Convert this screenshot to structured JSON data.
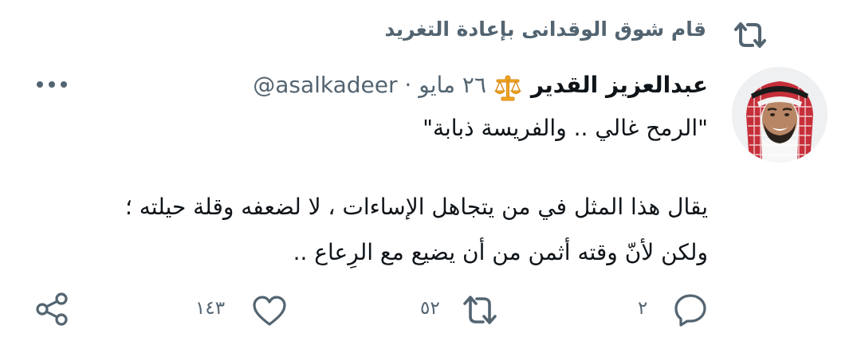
{
  "retweet": {
    "icon": "retweet-icon",
    "text": "قام شوق الوقدانى بإعادة التغريد"
  },
  "tweet": {
    "author_name": "عبدالعزيز القدير",
    "badge_icon": "scales-emoji",
    "handle": "@asalkadeer",
    "separator": "·",
    "date": "٢٦ مايو",
    "lines": [
      "\"الرمح غالي .. والفريسة ذبابة\"",
      "يقال هذا المثل في من يتجاهل الإساءات ، لا لضعفه وقلة حيلته ؛",
      "ولكن لأنّ وقته أثمن من أن يضيع مع الرِعاع .."
    ]
  },
  "actions": {
    "reply_count": "٢",
    "retweet_count": "٥٢",
    "like_count": "١٤٣"
  },
  "colors": {
    "muted": "#536471",
    "text": "#0f1419",
    "badge": "#f4a623"
  }
}
